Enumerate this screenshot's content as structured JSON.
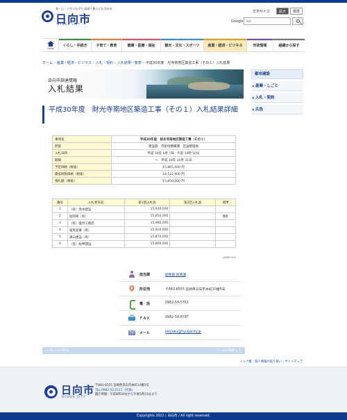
{
  "header": {
    "tagline": "海・山・人がつながり 笑顔で暮らせる日向市",
    "site_name": "日向市",
    "site_name_en": "HYUGA CITY",
    "font_size_label": "文字サイズ",
    "font_size_large": "拡大",
    "font_size_standard": "標準",
    "search_engine": "Google",
    "search_placeholder": "提供"
  },
  "nav": {
    "home": "HOME",
    "items": [
      {
        "label": "くらし・手続き",
        "color": "#3c8a3a"
      },
      {
        "label": "子育て・教育",
        "color": "#e87e3b"
      },
      {
        "label": "健康・医療・福祉",
        "color": "#d4576a"
      },
      {
        "label": "観光・文化・スポーツ",
        "color": "#3d8fc8"
      },
      {
        "label": "産業・経済・ビジネス",
        "color": "#e0a31f"
      },
      {
        "label": "市政情報",
        "color": "#6e4ea3"
      },
      {
        "label": "組織から探す",
        "color": "#777777"
      }
    ]
  },
  "breadcrumb": {
    "items": [
      "ホーム",
      "産業・経済・ビジネス",
      "入札・契約",
      "入札結果一覧表"
    ],
    "current": "平成30年度　光寺南地区築造工事（その１）入札結果"
  },
  "banner": {
    "subtitle": "日向市調達情報",
    "title": "入札結果"
  },
  "sidebar": {
    "heading": "都市建設",
    "items": [
      "産業・しごと",
      "入札・契約",
      "広告"
    ]
  },
  "page_title": "平成30年度　財光寺南地区築造工事（その１）入札結果詳細",
  "info_table": [
    {
      "label": "事項名",
      "value": "平成30年度　財光寺南地区築造工事（その１）",
      "bold": true
    },
    {
      "label": "所管",
      "value": "建設部　市街地整備課　区画整理係",
      "bold": false
    },
    {
      "label": "入札日時",
      "value": "平成 30年 6月 7日　午前 10時 50分",
      "bold": false
    },
    {
      "label": "期間",
      "value": "〜　平成 30年 10月 31日",
      "bold": false
    },
    {
      "label": "予定価格（税抜）",
      "value": "15,865,000 円",
      "bold": false
    },
    {
      "label": "最低制限価格（税抜）",
      "value": "14,122,000 円",
      "bold": false
    },
    {
      "label": "落札額（税抜）",
      "value": "15,850,000 円",
      "bold": false
    }
  ],
  "bid_table": {
    "headers": [
      "番号",
      "入札者氏名",
      "第1回入札高",
      "第2回入札高",
      "適用"
    ],
    "rows": [
      {
        "no": "1",
        "name": "（有）赤木建設",
        "r1": "15,930,000",
        "r2": "",
        "note": ""
      },
      {
        "no": "2",
        "name": "垣岡商（有）",
        "r1": "15,850,000",
        "r2": "",
        "note": "落札"
      },
      {
        "no": "3",
        "name": "（有）塩見工務店",
        "r1": "15,900,000",
        "r2": "",
        "note": ""
      },
      {
        "no": "4",
        "name": "塩見産業（有）",
        "r1": "15,910,000",
        "r2": "",
        "note": ""
      },
      {
        "no": "5",
        "name": "浦山建設（有）",
        "r1": "15,870,000",
        "r2": "",
        "note": ""
      },
      {
        "no": "6",
        "name": "（有）松甲建設",
        "r1": "15,890,000",
        "r2": "",
        "note": ""
      }
    ],
    "code": "18960701"
  },
  "contact": {
    "rows": [
      {
        "label": "担当課",
        "value": "総務部 財政課",
        "link": true,
        "icon": "person-icon"
      },
      {
        "label": "所在地",
        "value": "〒883-8555 宮崎県日向市本町10番5号",
        "link": false,
        "icon": "location-pin-icon"
      },
      {
        "label": "電　話",
        "value": "0982-54-5761",
        "link": false,
        "icon": "phone-icon"
      },
      {
        "label": "ＦＡＸ",
        "value": "0982-54-8747",
        "link": false,
        "icon": "fax-icon"
      },
      {
        "label": "メール",
        "value": "keiyaku@hyugacity.jp",
        "link": true,
        "icon": "mail-icon"
      }
    ]
  },
  "pager": {
    "left": "← ホームに戻る",
    "right": "ページの先頭へ ↑"
  },
  "footer_links": "リンク集｜個人情報の取り扱い｜サイトマップ",
  "footer": {
    "site_name": "日向市",
    "site_name_en": "HYUGA CITY",
    "address": "〒883-8555 宮崎県日向市本町10番5号",
    "tel": "TEL:0982-52-2111（代表）",
    "hours": "開庁時間：午前8時30分から午後5時15分まで"
  },
  "copyright": "Copyrights 2022 | 日向市 / All right reserved."
}
